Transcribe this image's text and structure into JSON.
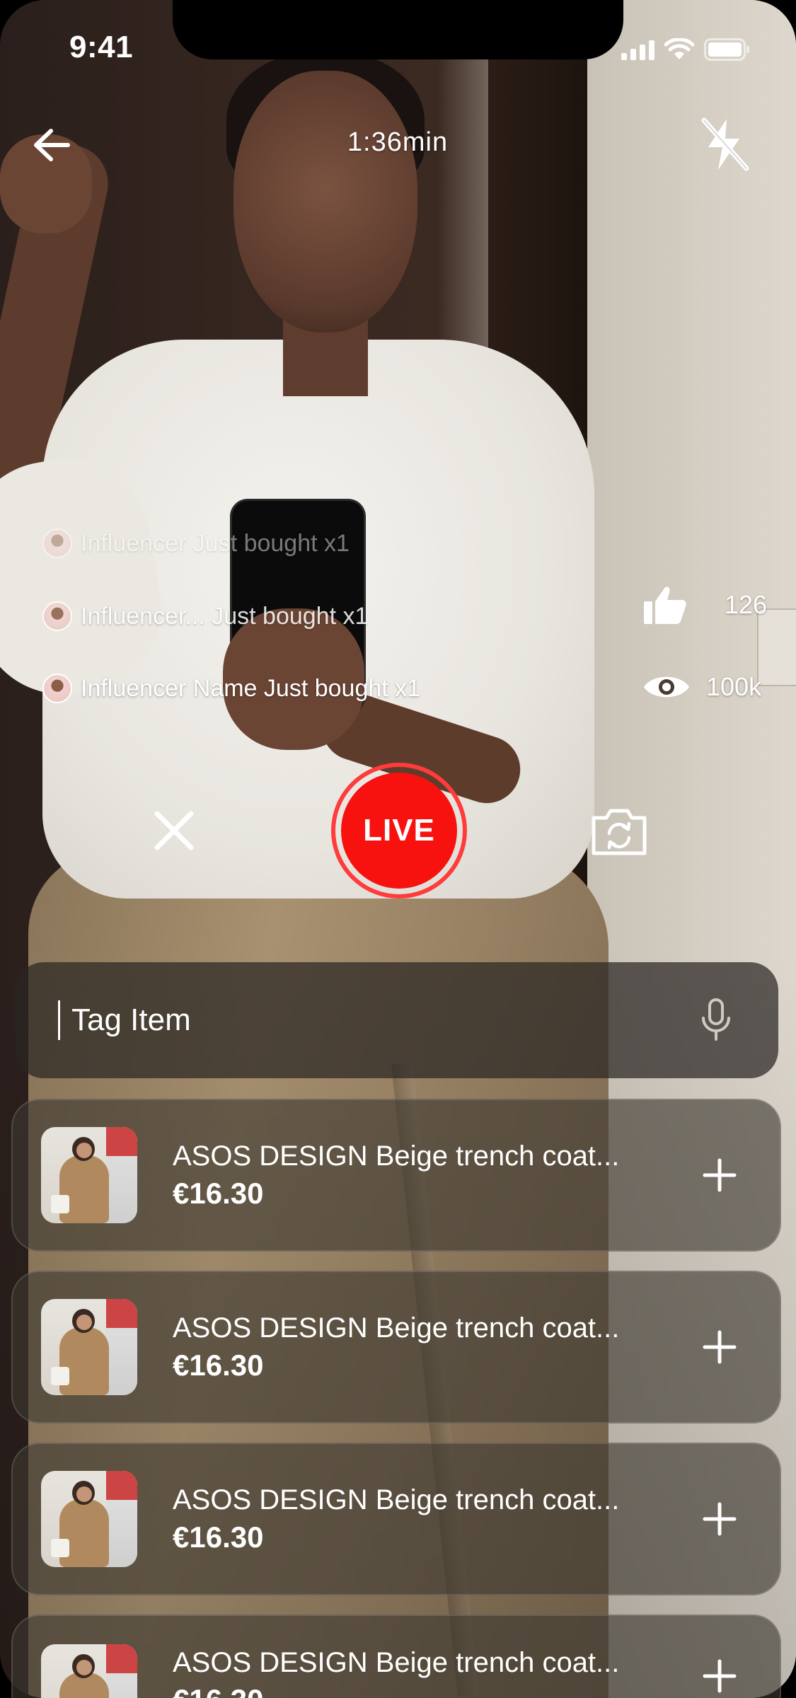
{
  "status_bar": {
    "time": "9:41"
  },
  "top_bar": {
    "timer": "1:36min"
  },
  "feed": [
    {
      "name": "Influencer",
      "action": "Just bought x1",
      "opacity": 0.45
    },
    {
      "name": "Influencer...",
      "action": "Just bought x1",
      "opacity": 0.85
    },
    {
      "name": "Influencer Name",
      "action": "Just bought x1",
      "opacity": 1.0
    }
  ],
  "stats": {
    "likes": "126",
    "views": "100k"
  },
  "controls": {
    "live_label": "LIVE"
  },
  "search": {
    "placeholder": "Tag Item"
  },
  "products": [
    {
      "name": "ASOS DESIGN Beige trench coat...",
      "price": "€16.30"
    },
    {
      "name": "ASOS DESIGN Beige trench coat...",
      "price": "€16.30"
    },
    {
      "name": "ASOS DESIGN Beige trench coat...",
      "price": "€16.30"
    },
    {
      "name": "ASOS DESIGN Beige trench coat...",
      "price": "€16.30"
    }
  ],
  "icons": {
    "back": "arrow-left-icon",
    "flash": "flash-off-icon",
    "like": "thumbs-up-icon",
    "views": "eye-icon",
    "close": "close-icon",
    "flip": "camera-flip-icon",
    "mic": "microphone-icon",
    "add": "plus-icon"
  },
  "colors": {
    "live_red": "#f7110f",
    "live_ring": "#ff3b3b"
  }
}
